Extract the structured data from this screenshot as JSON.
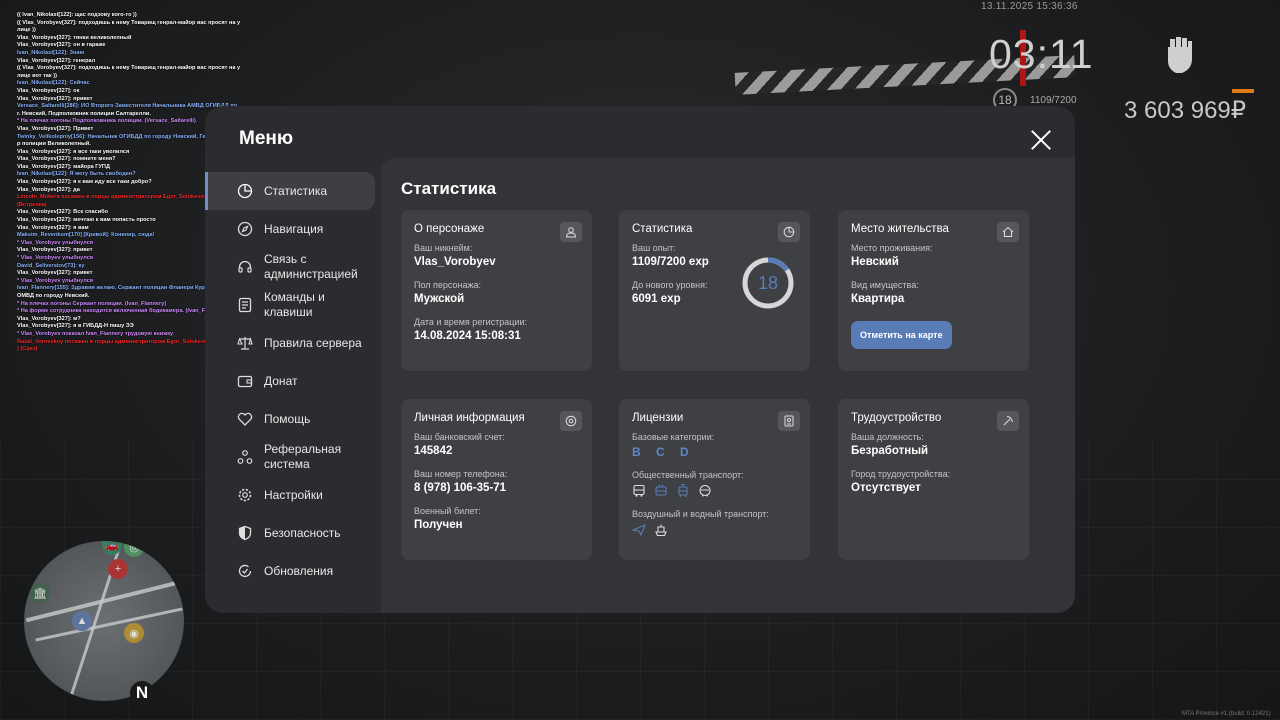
{
  "hud": {
    "date": "13.11.2025 15:36:36",
    "clock": "03:11",
    "level": "18",
    "exp": "1109/7200",
    "money": "3 603 969₽",
    "build": "MTA Province #1 (build: 0.12421)"
  },
  "chat": [
    {
      "text": "(( Ivan_Nikolast[122]: щас подзову кого-то ))",
      "color": "white"
    },
    {
      "text": "(( Vlas_Vorobyev[327]: подходишь к нему Товарищ генрал-майор вас просят на у",
      "color": "white"
    },
    {
      "text": "лице ))",
      "color": "white"
    },
    {
      "text": "Vlas_Vorobyev[327]: тянки великолепный",
      "color": "white"
    },
    {
      "text": "Vlas_Vorobyev[327]: он в гараже",
      "color": "white"
    },
    {
      "text": "Ivan_Nikolast[122]: Знаю",
      "color": "blue"
    },
    {
      "text": "Vlas_Vorobyev[327]: генерал",
      "color": "white"
    },
    {
      "text": "(( Vlas_Vorobyev[327]: подходишь к нему Товарищ генрал-майор вас просят на у",
      "color": "white"
    },
    {
      "text": "лице вот так ))",
      "color": "white"
    },
    {
      "text": "Ivan_Nikolast[122]: Сейчас",
      "color": "blue"
    },
    {
      "text": "Vlas_Vorobyev[327]: ок",
      "color": "white"
    },
    {
      "text": "Vlas_Vorobyev[327]: привет",
      "color": "white"
    },
    {
      "text": "Versace_Saltarelli[286]: ИО Второго Заместителя Начальника АМВД ОГИБДД по",
      "color": "blue"
    },
    {
      "text": " г. Невский, Подполковник полиции Салтарелли.",
      "color": "white"
    },
    {
      "text": " * На плечах погоны Подполковника полиции. (Versace_Saltarelli)",
      "color": "purple"
    },
    {
      "text": "Vlas_Vorobyev[327]: Привет",
      "color": "white"
    },
    {
      "text": "Twinky_Velikolepniy[156]: Начальник ОГИБДД по городу Невский, Генерал-майо",
      "color": "blue"
    },
    {
      "text": "р полиции Великолепный.",
      "color": "white"
    },
    {
      "text": "Vlas_Vorobyev[327]: я все таки уволился",
      "color": "white"
    },
    {
      "text": "Vlas_Vorobyev[327]: помните меня?",
      "color": "white"
    },
    {
      "text": "Vlas_Vorobyev[327]: майора ГУПД",
      "color": "white"
    },
    {
      "text": "Ivan_Nikolast[122]: Я могу быть свободен?",
      "color": "blue"
    },
    {
      "text": "Vlas_Vorobyev[327]: я к вам иду все таки добро?",
      "color": "white"
    },
    {
      "text": "Vlas_Vorobyev[327]: да",
      "color": "white"
    },
    {
      "text": "Lincoln_Mukera посажен в порцы администратором Egor_Solokevich (30 мин.)",
      "color": "red"
    },
    {
      "text": "(Встрелка)",
      "color": "red"
    },
    {
      "text": "Vlas_Vorobyev[327]: Все спасибо",
      "color": "white"
    },
    {
      "text": "Vlas_Vorobyev[327]: мечтаю к вам попасть просто",
      "color": "white"
    },
    {
      "text": "Vlas_Vorobyev[327]: я вам",
      "color": "white"
    },
    {
      "text": "Maksim_Revenkom[170] [Кривой]: Конвоир, сюда!",
      "color": "blue"
    },
    {
      "text": " * Vlas_Vorobyev улыбнулся",
      "color": "purple"
    },
    {
      "text": "Vlas_Vorobyev[327]: привет",
      "color": "white"
    },
    {
      "text": " * Vlas_Vorobyev улыбнулся",
      "color": "purple"
    },
    {
      "text": "David_Seliverstov[73]: ку",
      "color": "blue"
    },
    {
      "text": "Vlas_Vorobyev[327]: привет",
      "color": "white"
    },
    {
      "text": " * Vlas_Vorobyev улыбнулся",
      "color": "purple"
    },
    {
      "text": "Ivan_Flannery[155]: Здравия желаю, Сержант полиции Фланери Курсант АМВД",
      "color": "blue"
    },
    {
      "text": " ОМВД по городу Невский.",
      "color": "white"
    },
    {
      "text": " * На плечах погоны Сержант полиции. (Ivan_Flannery)",
      "color": "purple"
    },
    {
      "text": " * На форме сотрудника находится включенная бодикамера. (Ivan_Flannery)",
      "color": "purple"
    },
    {
      "text": "Vlas_Vorobyev[327]: м?",
      "color": "white"
    },
    {
      "text": "Vlas_Vorobyev[327]: я в ГИБДД-Н пишу ЭЭ",
      "color": "white"
    },
    {
      "text": " * Vlas_Vorobyev показал Ivan_Flannery трудовую книжку",
      "color": "purple"
    },
    {
      "text": "Raxal_Vorovskoy посажен в порцы администратором Egor_Solokevich (30 мин.",
      "color": "red"
    },
    {
      "text": ") (Срез)",
      "color": "red"
    }
  ],
  "menu": {
    "title": "Меню",
    "close_icon": "close-icon",
    "nav": [
      {
        "label": "Статистика",
        "icon": "pie-chart-icon",
        "active": true
      },
      {
        "label": "Навигация",
        "icon": "compass-icon"
      },
      {
        "label": "Связь с администрацией",
        "icon": "headset-icon"
      },
      {
        "label": "Команды и клавиши",
        "icon": "keyboard-icon"
      },
      {
        "label": "Правила сервера",
        "icon": "scales-icon"
      },
      {
        "label": "Донат",
        "icon": "wallet-icon"
      },
      {
        "label": "Помощь",
        "icon": "heart-hand-icon"
      },
      {
        "label": "Реферальная система",
        "icon": "network-icon"
      },
      {
        "label": "Настройки",
        "icon": "gear-icon"
      },
      {
        "label": "Безопасность",
        "icon": "shield-icon"
      },
      {
        "label": "Обновления",
        "icon": "refresh-check-icon"
      }
    ]
  },
  "stats": {
    "title": "Статистика",
    "cards": {
      "character": {
        "title": "О персонаже",
        "icon": "user-icon",
        "nick_label": "Ваш никнейм:",
        "nick": "Vlas_Vorobyev",
        "gender_label": "Пол персонажа:",
        "gender": "Мужской",
        "reg_label": "Дата и время регистрации:",
        "reg": "14.08.2024 15:08:31"
      },
      "statistics": {
        "title": "Статистика",
        "icon": "clock-pie-icon",
        "exp_label": "Ваш опыт:",
        "exp": "1109/7200 exp",
        "next_label": "До нового уровня:",
        "next": "6091 exp",
        "level": "18",
        "level_progress": 0.154
      },
      "residence": {
        "title": "Место жительства",
        "icon": "home-icon",
        "place_label": "Место проживания:",
        "place": "Невский",
        "property_label": "Вид имущества:",
        "property": "Квартира",
        "map_button": "Отметить на карте"
      },
      "personal": {
        "title": "Личная информация",
        "icon": "at-sign-icon",
        "bank_label": "Ваш банковский счет:",
        "bank": "145842",
        "phone_label": "Ваш номер телефона:",
        "phone": "8 (978) 106-35-71",
        "military_label": "Военный билет:",
        "military": "Получен"
      },
      "licenses": {
        "title": "Лицензии",
        "icon": "id-card-icon",
        "basic_label": "Базовые категории:",
        "basic": "B C D",
        "public_label": "Общественный транспорт:",
        "public_icons": [
          "bus-icon",
          "trolleybus-icon",
          "tram-icon",
          "metro-icon"
        ],
        "air_label": "Воздушный и водный транспорт:",
        "air_icons": [
          "plane-icon",
          "ship-icon"
        ]
      },
      "employment": {
        "title": "Трудоустройство",
        "icon": "pickaxe-icon",
        "position_label": "Ваша должность:",
        "position": "Безработный",
        "city_label": "Город трудоустройства:",
        "city": "Отсутствует"
      }
    }
  },
  "colors": {
    "accent": "#5a7cb6",
    "window": "#2b2c2f",
    "content": "#333438",
    "card": "#3f4044"
  }
}
